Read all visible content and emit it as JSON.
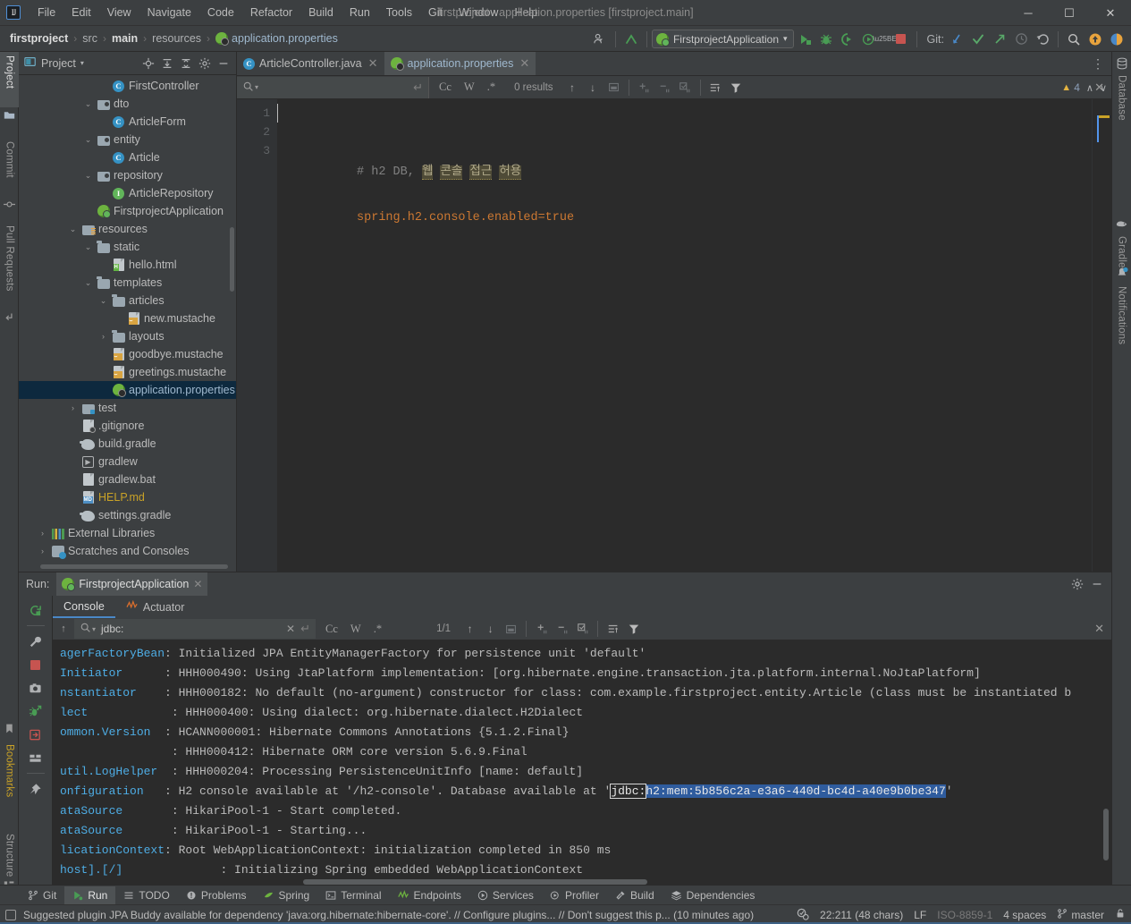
{
  "window": {
    "title": "firstproject - application.properties [firstproject.main]",
    "minimize": "─",
    "maximize": "☐",
    "close": "✕",
    "logo": "IJ"
  },
  "menubar": {
    "items": [
      "File",
      "Edit",
      "View",
      "Navigate",
      "Code",
      "Refactor",
      "Build",
      "Run",
      "Tools",
      "Git",
      "Window",
      "Help"
    ]
  },
  "breadcrumb": {
    "items": [
      {
        "label": "firstproject",
        "style": "bold"
      },
      {
        "label": "src",
        "style": "plain"
      },
      {
        "label": "main",
        "style": "bold"
      },
      {
        "label": "resources",
        "style": "plain"
      },
      {
        "label": "application.properties",
        "style": "file"
      }
    ],
    "separator": "›"
  },
  "toolbar": {
    "run_config": "FirstprojectApplication",
    "git_label": "Git:",
    "chevron": "▾",
    "icons": {
      "profile": "user-settings-icon",
      "back_arrow": "build-arrow-icon",
      "run": "run-icon",
      "debug": "debug-icon",
      "run_coverage": "run-with-coverage-icon",
      "profiler": "profiler-icon",
      "stop": "stop-icon",
      "update_project": "git-update-icon",
      "commit": "git-commit-icon",
      "push": "git-push-icon",
      "history": "history-icon",
      "rollback": "rollback-icon",
      "search_everywhere": "search-everywhere-icon",
      "notifications": "ide-update-icon",
      "account": "account-icon"
    }
  },
  "left_strip": {
    "tabs": [
      {
        "label": "Project",
        "icon": "project-icon",
        "active": true
      },
      {
        "label": "Commit",
        "icon": "commit-icon",
        "active": false
      },
      {
        "label": "Pull Requests",
        "icon": "pull-requests-icon",
        "active": false
      }
    ],
    "bottom_tabs": [
      {
        "label": "Bookmarks",
        "icon": "bookmarks-icon"
      },
      {
        "label": "Structure",
        "icon": "structure-icon"
      }
    ]
  },
  "right_strip": {
    "tabs": [
      {
        "label": "Database",
        "icon": "database-icon"
      },
      {
        "label": "Gradle",
        "icon": "gradle-icon"
      },
      {
        "label": "Notifications",
        "icon": "notifications-icon"
      }
    ]
  },
  "project_panel": {
    "title": "Project",
    "chevron": "▾",
    "buttons": [
      "locate-icon",
      "expand-all-icon",
      "collapse-all-icon",
      "gear-icon",
      "hide-icon"
    ],
    "tree": [
      {
        "indent": 5,
        "arrow": "",
        "icon": "class",
        "label": "FirstController"
      },
      {
        "indent": 4,
        "arrow": "⌄",
        "icon": "package",
        "label": "dto"
      },
      {
        "indent": 5,
        "arrow": "",
        "icon": "class",
        "label": "ArticleForm"
      },
      {
        "indent": 4,
        "arrow": "⌄",
        "icon": "package",
        "label": "entity"
      },
      {
        "indent": 5,
        "arrow": "",
        "icon": "class",
        "label": "Article"
      },
      {
        "indent": 4,
        "arrow": "⌄",
        "icon": "package",
        "label": "repository"
      },
      {
        "indent": 5,
        "arrow": "",
        "icon": "interface",
        "label": "ArticleRepository"
      },
      {
        "indent": 4,
        "arrow": "",
        "icon": "spring-run",
        "label": "FirstprojectApplication"
      },
      {
        "indent": 3,
        "arrow": "⌄",
        "icon": "folder-res",
        "label": "resources"
      },
      {
        "indent": 4,
        "arrow": "⌄",
        "icon": "folder",
        "label": "static"
      },
      {
        "indent": 5,
        "arrow": "",
        "icon": "html",
        "label": "hello.html"
      },
      {
        "indent": 4,
        "arrow": "⌄",
        "icon": "folder",
        "label": "templates"
      },
      {
        "indent": 5,
        "arrow": "⌄",
        "icon": "folder",
        "label": "articles"
      },
      {
        "indent": 6,
        "arrow": "",
        "icon": "mustache",
        "label": "new.mustache"
      },
      {
        "indent": 5,
        "arrow": "›",
        "icon": "folder",
        "label": "layouts"
      },
      {
        "indent": 5,
        "arrow": "",
        "icon": "mustache",
        "label": "goodbye.mustache"
      },
      {
        "indent": 5,
        "arrow": "",
        "icon": "mustache",
        "label": "greetings.mustache"
      },
      {
        "indent": 5,
        "arrow": "",
        "icon": "spring",
        "label": "application.properties",
        "selected": true
      },
      {
        "indent": 3,
        "arrow": "›",
        "icon": "folder-src",
        "label": "test"
      },
      {
        "indent": 3,
        "arrow": "",
        "icon": "gitignore",
        "label": ".gitignore"
      },
      {
        "indent": 3,
        "arrow": "",
        "icon": "gradle",
        "label": "build.gradle"
      },
      {
        "indent": 3,
        "arrow": "",
        "icon": "script",
        "label": "gradlew"
      },
      {
        "indent": 3,
        "arrow": "",
        "icon": "file",
        "label": "gradlew.bat"
      },
      {
        "indent": 3,
        "arrow": "",
        "icon": "md",
        "label": "HELP.md",
        "color": "yellow"
      },
      {
        "indent": 3,
        "arrow": "",
        "icon": "gradle",
        "label": "settings.gradle"
      },
      {
        "indent": 1,
        "arrow": "›",
        "icon": "libs",
        "label": "External Libraries"
      },
      {
        "indent": 1,
        "arrow": "›",
        "icon": "scratch",
        "label": "Scratches and Consoles"
      }
    ]
  },
  "editor": {
    "tabs": [
      {
        "label": "ArticleController.java",
        "icon": "class",
        "active": false,
        "close": "✕"
      },
      {
        "label": "application.properties",
        "icon": "spring",
        "active": true,
        "close": "✕"
      }
    ],
    "kebab": "⋮",
    "find": {
      "placeholder": "",
      "value": "",
      "search_icon": "search-icon",
      "history_chevron": "▾",
      "regex_reset": "↵",
      "match_case": "Cc",
      "words": "W",
      "regex": ".*",
      "results": "0 results",
      "prev": "↑",
      "next": "↓",
      "select_all": "⬚",
      "add_line": "add-occurrence-icon",
      "remove_line": "remove-occurrence-icon",
      "select_all_occurrences": "select-all-occurrences-icon",
      "filter_lines": "filter-lines-icon",
      "filter": "filter-icon",
      "close": "✕"
    },
    "gutter_lines": [
      "1",
      "2",
      "3"
    ],
    "code": {
      "line1_prefix": "# h2 DB, ",
      "line1_typos": [
        "웹",
        "콘솔",
        "접근",
        "허용"
      ],
      "line2_key": "spring.h2.console.enabled",
      "line2_eq": "=",
      "line2_val": "true"
    },
    "inspections": {
      "warning_count": "4",
      "warning_icon": "warning-triangle-icon",
      "up": "∧",
      "down": "∨"
    }
  },
  "run_panel": {
    "label": "Run:",
    "tab": "FirstprojectApplication",
    "tab_close": "✕",
    "head_buttons": [
      "gear-icon",
      "hide-icon"
    ],
    "gutter_buttons": [
      "rerun-icon",
      "settings-wrench-icon",
      "stop-icon",
      "screenshot-icon",
      "thread-dump-icon",
      "export-icon",
      "layout-icon",
      "pin-icon"
    ],
    "console_tabs": [
      {
        "label": "Console",
        "icon": "console-icon",
        "active": true
      },
      {
        "label": "Actuator",
        "icon": "actuator-icon",
        "active": false
      }
    ],
    "find": {
      "value": "jdbc:",
      "search_icon": "search-icon",
      "history_chevron": "▾",
      "clear": "✕",
      "regex_reset": "↵",
      "match_case": "Cc",
      "words": "W",
      "regex": ".*",
      "results": "1/1",
      "prev": "↑",
      "next": "↓",
      "select_all": "⬚",
      "close": "✕"
    },
    "console_lines": [
      {
        "cat": "host].[/]",
        "pad": 14,
        "text": ": Initializing Spring embedded WebApplicationContext"
      },
      {
        "cat": "licationContext",
        "pad": 0,
        "text": ": Root WebApplicationContext: initialization completed in 850 ms"
      },
      {
        "cat": "ataSource",
        "pad": 7,
        "text": ": HikariPool-1 - Starting..."
      },
      {
        "cat": "ataSource",
        "pad": 7,
        "text": ": HikariPool-1 - Start completed."
      },
      {
        "cat": "onfiguration",
        "pad": 3,
        "text": ": H2 console available at '/h2-console'. Database available at '",
        "jdbc_prefix": "jdbc:",
        "jdbc_rest": "h2:mem:5b856c2a-e3a6-440d-bc4d-a40e9b0be347",
        "suffix": "'"
      },
      {
        "cat": "util.LogHelper",
        "pad": 2,
        "text": ": HHH000204: Processing PersistenceUnitInfo [name: default]"
      },
      {
        "cat": "",
        "pad": 16,
        "text": ": HHH000412: Hibernate ORM core version 5.6.9.Final"
      },
      {
        "cat": "ommon.Version",
        "pad": 2,
        "text": ": HCANN000001: Hibernate Commons Annotations {5.1.2.Final}"
      },
      {
        "cat": "lect",
        "pad": 12,
        "text": ": HHH000400: Using dialect: org.hibernate.dialect.H2Dialect"
      },
      {
        "cat": "nstantiator",
        "pad": 4,
        "text": ": HHH000182: No default (no-argument) constructor for class: com.example.firstproject.entity.Article (class must be instantiated b"
      },
      {
        "cat": "Initiator",
        "pad": 6,
        "text": ": HHH000490: Using JtaPlatform implementation: [org.hibernate.engine.transaction.jta.platform.internal.NoJtaPlatform]"
      },
      {
        "cat": "agerFactoryBean",
        "pad": 0,
        "text": ": Initialized JPA EntityManagerFactory for persistence unit 'default'"
      }
    ]
  },
  "bottom_bar": {
    "tabs": [
      {
        "label": "Git",
        "icon": "git-branch-icon",
        "active": false
      },
      {
        "label": "Run",
        "icon": "run-icon",
        "active": true
      },
      {
        "label": "TODO",
        "icon": "todo-icon",
        "active": false
      },
      {
        "label": "Problems",
        "icon": "problems-icon",
        "active": false
      },
      {
        "label": "Spring",
        "icon": "spring-icon",
        "active": false
      },
      {
        "label": "Terminal",
        "icon": "terminal-icon",
        "active": false
      },
      {
        "label": "Endpoints",
        "icon": "endpoints-icon",
        "active": false
      },
      {
        "label": "Services",
        "icon": "services-icon",
        "active": false
      },
      {
        "label": "Profiler",
        "icon": "profiler-icon",
        "active": false
      },
      {
        "label": "Build",
        "icon": "build-hammer-icon",
        "active": false
      },
      {
        "label": "Dependencies",
        "icon": "dependencies-icon",
        "active": false
      }
    ]
  },
  "status_bar": {
    "message": "Suggested plugin JPA Buddy available for dependency 'java:org.hibernate:hibernate-core'. // Configure plugins... // Don't suggest this p... (10 minutes ago)",
    "inspection_icon": "inspection-widget-icon",
    "caret_position": "22:211 (48 chars)",
    "line_separator": "LF",
    "encoding": "ISO-8859-1",
    "indent": "4 spaces",
    "branch": "master",
    "branch_icon": "git-branch-icon",
    "lock_icon": "read-only-lock-icon"
  }
}
